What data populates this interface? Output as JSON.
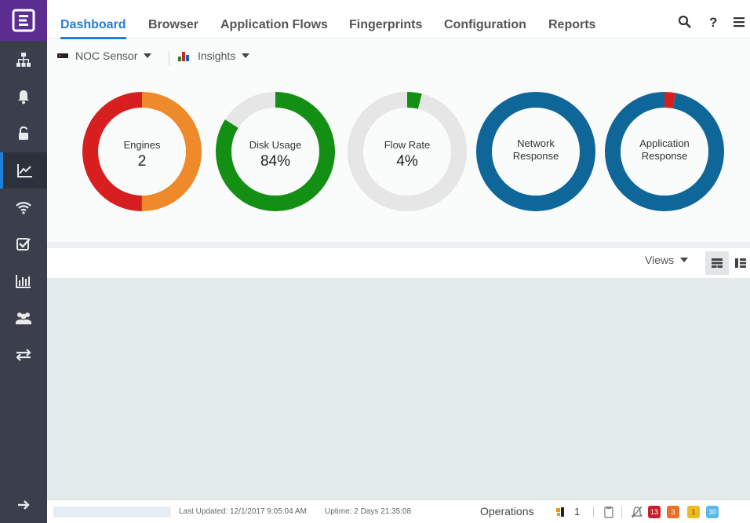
{
  "nav": {
    "tabs": [
      {
        "label": "Dashboard"
      },
      {
        "label": "Browser"
      },
      {
        "label": "Application Flows"
      },
      {
        "label": "Fingerprints"
      },
      {
        "label": "Configuration"
      },
      {
        "label": "Reports"
      }
    ],
    "help_label": "?"
  },
  "sidebar": {
    "items": [
      {
        "icon": "sitemap-icon"
      },
      {
        "icon": "bell-icon"
      },
      {
        "icon": "unlock-icon"
      },
      {
        "icon": "line-chart-icon",
        "active": true
      },
      {
        "icon": "wifi-icon"
      },
      {
        "icon": "checkbox-icon"
      },
      {
        "icon": "bar-chart-icon"
      },
      {
        "icon": "users-icon"
      },
      {
        "icon": "exchange-icon"
      }
    ],
    "collapse_icon": "arrow-right-icon"
  },
  "toolbar": {
    "sensor_label": "NOC Sensor",
    "insights_label": "Insights"
  },
  "donuts": [
    {
      "label": "Engines",
      "value": "2",
      "segments": [
        {
          "fraction": 0.5,
          "color": "#ee8a2a"
        },
        {
          "fraction": 0.5,
          "color": "#d71f1f"
        }
      ]
    },
    {
      "label": "Disk Usage",
      "value": "84%",
      "segments": [
        {
          "fraction": 0.84,
          "color": "#138f13"
        },
        {
          "fraction": 0.16,
          "color": "#e6e6e6"
        }
      ]
    },
    {
      "label": "Flow Rate",
      "value": "4%",
      "segments": [
        {
          "fraction": 0.04,
          "color": "#138f13"
        },
        {
          "fraction": 0.96,
          "color": "#e6e6e6"
        }
      ]
    },
    {
      "label_line1": "Network",
      "label_line2": "Response",
      "segments": [
        {
          "fraction": 1.0,
          "color": "#0e6699"
        }
      ]
    },
    {
      "label_line1": "Application",
      "label_line2": "Response",
      "segments": [
        {
          "fraction": 0.03,
          "color": "#d71f1f"
        },
        {
          "fraction": 0.97,
          "color": "#0e6699"
        }
      ]
    }
  ],
  "views": {
    "label": "Views"
  },
  "status": {
    "last_updated": "Last Updated: 12/1/2017 9:05:04 AM",
    "uptime": "Uptime: 2 Days 21:35:08",
    "operations_label": "Operations",
    "operations_count": "1",
    "badges": [
      {
        "value": "13",
        "color": "#c8202a"
      },
      {
        "value": "3",
        "color": "#e8702a"
      },
      {
        "value": "1",
        "color": "#f2b824"
      },
      {
        "value": "30",
        "color": "#5bb8e6"
      }
    ]
  }
}
